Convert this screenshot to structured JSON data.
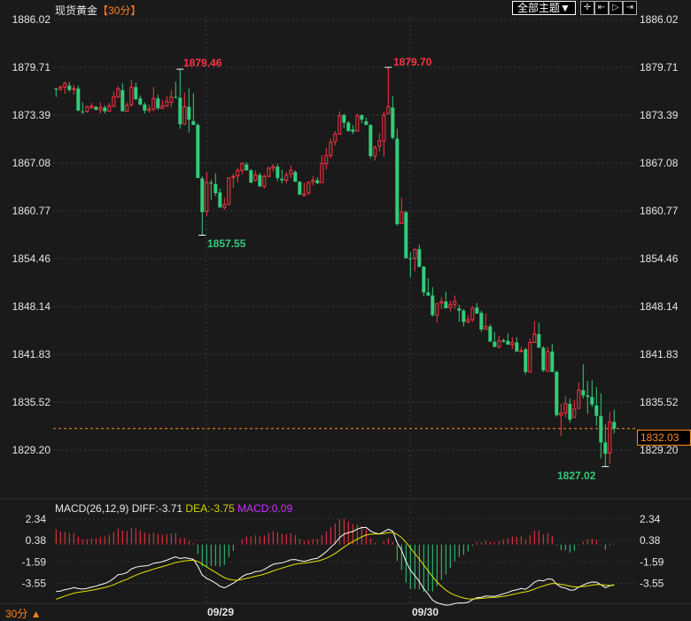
{
  "header": {
    "title": "现货黄金",
    "period": "【30分】",
    "theme_button": "全部主题▼",
    "tools": [
      {
        "name": "crosshair",
        "glyph": "✛"
      },
      {
        "name": "zoom-range",
        "glyph": "⇤"
      },
      {
        "name": "play",
        "glyph": "▷"
      },
      {
        "name": "exit",
        "glyph": "⇥"
      }
    ]
  },
  "price_axis": {
    "ticks": [
      "1886.02",
      "1879.71",
      "1873.39",
      "1867.08",
      "1860.77",
      "1854.46",
      "1848.14",
      "1841.83",
      "1835.52",
      "1829.20"
    ],
    "min": 1829.2,
    "max": 1886.02,
    "last_price": "1832.03",
    "last_value": 1832.03
  },
  "annotations": {
    "high1": "1879.46",
    "high2": "1879.70",
    "low1": "1857.55",
    "low2": "1827.02"
  },
  "macd": {
    "label": "MACD(26,12,9)",
    "diff": "DIFF:-3.71",
    "dea": "DEA:-3.75",
    "macd": "MACD:0.09",
    "ticks": [
      "2.34",
      "0.38",
      "-1.59",
      "-3.55"
    ]
  },
  "footer": {
    "period": "30分 ▲",
    "dates": [
      "09/29",
      "09/30"
    ]
  },
  "colors": {
    "up": "#ff3344",
    "down": "#33cc7a",
    "accent": "#ff8c1a",
    "dea": "#e6e600",
    "diff": "#ffffff"
  },
  "chart_data": {
    "type": "candlestick",
    "title": "现货黄金 30分",
    "ylim": [
      1829.2,
      1886.02
    ],
    "x_labels": {
      "09/29": 34,
      "09/30": 80
    },
    "ohlc": [
      [
        1876.9,
        1877.0,
        1875.8,
        1876.8
      ],
      [
        1876.8,
        1877.3,
        1876.6,
        1877.1
      ],
      [
        1877.1,
        1877.8,
        1876.2,
        1877.6
      ],
      [
        1877.3,
        1877.8,
        1876.5,
        1876.7
      ],
      [
        1876.8,
        1877.4,
        1876.1,
        1876.9
      ],
      [
        1876.9,
        1877.3,
        1873.9,
        1874.0
      ],
      [
        1873.9,
        1875.1,
        1873.5,
        1873.8
      ],
      [
        1873.9,
        1874.6,
        1873.7,
        1874.5
      ],
      [
        1874.4,
        1875.0,
        1874.2,
        1874.6
      ],
      [
        1874.5,
        1874.6,
        1874.0,
        1874.1
      ],
      [
        1874.1,
        1875.1,
        1873.6,
        1874.4
      ],
      [
        1874.4,
        1874.7,
        1873.6,
        1873.9
      ],
      [
        1873.9,
        1875.0,
        1873.9,
        1874.6
      ],
      [
        1874.6,
        1876.5,
        1874.4,
        1875.8
      ],
      [
        1875.8,
        1877.2,
        1875.7,
        1876.9
      ],
      [
        1876.7,
        1877.6,
        1873.9,
        1873.9
      ],
      [
        1873.9,
        1875.1,
        1873.9,
        1874.7
      ],
      [
        1874.8,
        1878.1,
        1874.5,
        1877.1
      ],
      [
        1877.1,
        1877.7,
        1875.4,
        1875.5
      ],
      [
        1875.6,
        1876.0,
        1874.7,
        1874.8
      ],
      [
        1874.8,
        1875.1,
        1873.6,
        1874.0
      ],
      [
        1874.0,
        1874.8,
        1873.7,
        1874.2
      ],
      [
        1874.2,
        1877.1,
        1873.9,
        1875.6
      ],
      [
        1875.6,
        1876.1,
        1874.1,
        1874.3
      ],
      [
        1874.3,
        1875.4,
        1874.2,
        1874.6
      ],
      [
        1874.6,
        1875.9,
        1874.5,
        1875.2
      ],
      [
        1875.1,
        1876.7,
        1874.4,
        1875.8
      ],
      [
        1875.8,
        1877.8,
        1875.6,
        1875.7
      ],
      [
        1875.7,
        1879.46,
        1871.6,
        1872.2
      ],
      [
        1872.2,
        1876.4,
        1872.2,
        1874.5
      ],
      [
        1874.5,
        1876.9,
        1871.1,
        1872.8
      ],
      [
        1872.6,
        1876.3,
        1872.1,
        1872.1
      ],
      [
        1872.1,
        1872.3,
        1865.1,
        1865.1
      ],
      [
        1865.05,
        1865.3,
        1857.55,
        1860.6
      ],
      [
        1860.7,
        1865.9,
        1860.1,
        1864.5
      ],
      [
        1864.5,
        1864.9,
        1862.2,
        1864.4
      ],
      [
        1864.3,
        1865.7,
        1862.7,
        1863.1
      ],
      [
        1863.2,
        1863.7,
        1861.2,
        1861.2
      ],
      [
        1861.2,
        1862.5,
        1860.9,
        1861.6
      ],
      [
        1861.6,
        1865.2,
        1861.5,
        1865.1
      ],
      [
        1865.2,
        1865.7,
        1863.8,
        1865.3
      ],
      [
        1865.4,
        1866.4,
        1864.5,
        1866.1
      ],
      [
        1866.1,
        1867.2,
        1865.6,
        1867.0
      ],
      [
        1866.9,
        1867.2,
        1866.1,
        1866.1
      ],
      [
        1866.1,
        1866.3,
        1864.4,
        1864.5
      ],
      [
        1864.8,
        1866.1,
        1864.6,
        1865.5
      ],
      [
        1865.5,
        1865.8,
        1863.9,
        1864.0
      ],
      [
        1864.0,
        1865.6,
        1863.7,
        1865.3
      ],
      [
        1865.3,
        1866.6,
        1865.3,
        1866.4
      ],
      [
        1866.4,
        1867.0,
        1865.9,
        1866.6
      ],
      [
        1866.6,
        1867.0,
        1864.7,
        1865.1
      ],
      [
        1865.0,
        1866.2,
        1864.4,
        1864.8
      ],
      [
        1864.8,
        1865.9,
        1864.4,
        1865.5
      ],
      [
        1865.6,
        1866.8,
        1865.1,
        1866.1
      ],
      [
        1865.9,
        1866.1,
        1864.6,
        1864.6
      ],
      [
        1864.6,
        1864.7,
        1862.9,
        1862.9
      ],
      [
        1862.8,
        1864.5,
        1862.7,
        1863.0
      ],
      [
        1863.1,
        1864.7,
        1862.9,
        1864.5
      ],
      [
        1864.6,
        1865.4,
        1864.1,
        1864.8
      ],
      [
        1864.8,
        1865.2,
        1864.3,
        1864.4
      ],
      [
        1864.5,
        1868.1,
        1864.5,
        1867.0
      ],
      [
        1867.0,
        1869.1,
        1866.2,
        1868.1
      ],
      [
        1868.1,
        1870.3,
        1867.7,
        1869.8
      ],
      [
        1869.9,
        1871.3,
        1869.4,
        1870.9
      ],
      [
        1870.9,
        1873.9,
        1870.8,
        1873.3
      ],
      [
        1873.4,
        1873.6,
        1871.7,
        1872.4
      ],
      [
        1872.4,
        1872.6,
        1871.2,
        1871.3
      ],
      [
        1871.5,
        1872.1,
        1870.9,
        1871.2
      ],
      [
        1871.3,
        1873.6,
        1871.2,
        1873.3
      ],
      [
        1873.4,
        1873.5,
        1872.3,
        1872.8
      ],
      [
        1872.6,
        1873.1,
        1872.1,
        1872.1
      ],
      [
        1872.1,
        1872.2,
        1867.7,
        1868.0
      ],
      [
        1868.0,
        1869.4,
        1867.4,
        1869.1
      ],
      [
        1869.3,
        1871.0,
        1868.6,
        1870.0
      ],
      [
        1870.0,
        1873.9,
        1867.9,
        1873.4
      ],
      [
        1873.6,
        1879.7,
        1873.5,
        1874.5
      ],
      [
        1874.4,
        1875.9,
        1870.2,
        1870.4
      ],
      [
        1870.3,
        1871.6,
        1858.8,
        1859.0
      ],
      [
        1859.1,
        1862.5,
        1859.0,
        1860.6
      ],
      [
        1860.6,
        1860.8,
        1854.5,
        1854.5
      ],
      [
        1854.5,
        1855.3,
        1852.0,
        1854.4
      ],
      [
        1854.5,
        1855.8,
        1852.8,
        1855.7
      ],
      [
        1855.7,
        1856.3,
        1853.3,
        1853.4
      ],
      [
        1853.4,
        1853.5,
        1849.5,
        1850.0
      ],
      [
        1850.0,
        1851.9,
        1849.5,
        1849.6
      ],
      [
        1849.6,
        1850.7,
        1846.8,
        1847.0
      ],
      [
        1847.0,
        1848.6,
        1846.0,
        1848.5
      ],
      [
        1848.6,
        1849.4,
        1847.8,
        1848.8
      ],
      [
        1848.8,
        1850.1,
        1847.9,
        1847.9
      ],
      [
        1848.0,
        1848.9,
        1847.5,
        1848.4
      ],
      [
        1848.4,
        1849.6,
        1847.8,
        1848.8
      ],
      [
        1847.9,
        1848.4,
        1846.1,
        1847.6
      ],
      [
        1847.6,
        1847.8,
        1845.5,
        1846.1
      ],
      [
        1846.1,
        1847.0,
        1845.9,
        1846.4
      ],
      [
        1846.4,
        1848.2,
        1846.1,
        1847.9
      ],
      [
        1848.0,
        1848.6,
        1847.2,
        1847.2
      ],
      [
        1847.3,
        1847.6,
        1844.8,
        1845.1
      ],
      [
        1845.1,
        1847.2,
        1845.1,
        1845.5
      ],
      [
        1845.5,
        1845.8,
        1843.5,
        1843.5
      ],
      [
        1843.5,
        1844.8,
        1842.8,
        1842.8
      ],
      [
        1842.8,
        1844.3,
        1842.6,
        1843.6
      ],
      [
        1843.7,
        1843.9,
        1843.4,
        1843.5
      ],
      [
        1843.6,
        1844.6,
        1843.1,
        1843.1
      ],
      [
        1843.1,
        1844.1,
        1842.5,
        1843.4
      ],
      [
        1843.4,
        1844.1,
        1842.2,
        1842.2
      ],
      [
        1842.2,
        1842.8,
        1842.2,
        1842.3
      ],
      [
        1842.5,
        1842.7,
        1839.2,
        1839.5
      ],
      [
        1839.5,
        1843.9,
        1839.5,
        1843.4
      ],
      [
        1843.4,
        1846.2,
        1843.4,
        1844.5
      ],
      [
        1844.5,
        1846.0,
        1842.7,
        1842.7
      ],
      [
        1842.7,
        1842.9,
        1839.5,
        1839.7
      ],
      [
        1839.6,
        1842.8,
        1839.6,
        1842.2
      ],
      [
        1842.2,
        1843.2,
        1839.5,
        1839.5
      ],
      [
        1839.5,
        1839.7,
        1833.6,
        1833.8
      ],
      [
        1833.8,
        1835.3,
        1831.0,
        1834.1
      ],
      [
        1834.1,
        1836.3,
        1833.5,
        1835.3
      ],
      [
        1835.3,
        1836.0,
        1832.8,
        1833.2
      ],
      [
        1833.5,
        1835.8,
        1833.5,
        1834.6
      ],
      [
        1834.7,
        1838.1,
        1834.7,
        1837.1
      ],
      [
        1837.1,
        1840.5,
        1836.0,
        1836.4
      ],
      [
        1836.4,
        1838.3,
        1834.0,
        1836.2
      ],
      [
        1836.2,
        1838.4,
        1834.9,
        1835.2
      ],
      [
        1835.1,
        1837.5,
        1832.4,
        1833.7
      ],
      [
        1833.7,
        1836.7,
        1828.1,
        1830.2
      ],
      [
        1830.2,
        1832.6,
        1827.02,
        1828.7
      ],
      [
        1828.8,
        1834.2,
        1827.4,
        1832.9
      ],
      [
        1832.9,
        1834.5,
        1831.4,
        1832.03
      ]
    ],
    "macd_ylim": [
      -4.5,
      2.8
    ],
    "macd_seed": {
      "diff": -4.3,
      "dea": -5.0
    }
  }
}
